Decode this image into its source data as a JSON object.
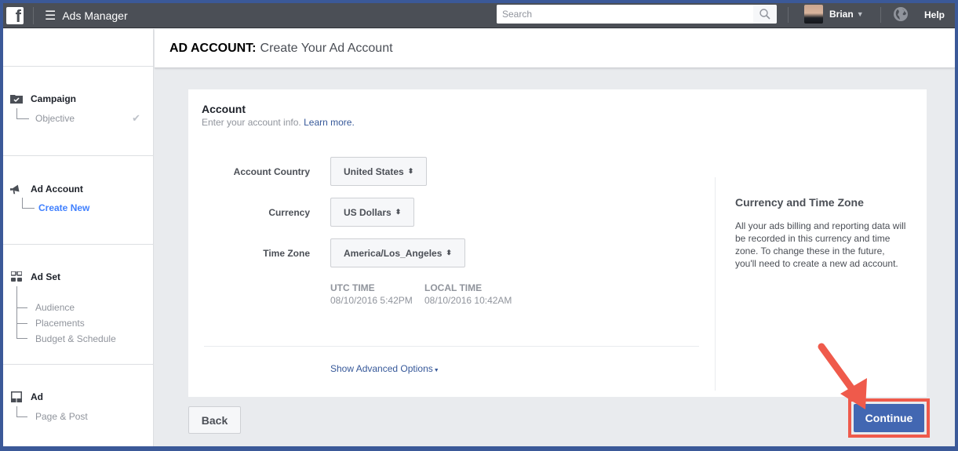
{
  "topbar": {
    "logo_glyph": "f",
    "menu_icon": "☰",
    "app_title": "Ads Manager",
    "search_placeholder": "Search",
    "user_name": "Brian",
    "help_label": "Help"
  },
  "sidebar": {
    "sections": [
      {
        "title": "Campaign",
        "icon": "folder-check-icon",
        "items": [
          {
            "label": "Objective",
            "completed": true
          }
        ]
      },
      {
        "title": "Ad Account",
        "icon": "megaphone-icon",
        "items": [
          {
            "label": "Create New",
            "active": true
          }
        ]
      },
      {
        "title": "Ad Set",
        "icon": "grid-icon",
        "items": [
          {
            "label": "Audience"
          },
          {
            "label": "Placements"
          },
          {
            "label": "Budget & Schedule"
          }
        ]
      },
      {
        "title": "Ad",
        "icon": "ad-layout-icon",
        "items": [
          {
            "label": "Page & Post"
          }
        ]
      }
    ]
  },
  "header": {
    "prefix": "AD ACCOUNT:",
    "title": "Create Your Ad Account"
  },
  "account": {
    "title": "Account",
    "description": "Enter your account info.",
    "learn_more": "Learn more.",
    "fields": {
      "country": {
        "label": "Account Country",
        "value": "United States"
      },
      "currency": {
        "label": "Currency",
        "value": "US Dollars"
      },
      "timezone": {
        "label": "Time Zone",
        "value": "America/Los_Angeles"
      }
    },
    "utc": {
      "label": "UTC TIME",
      "value": "08/10/2016 5:42PM"
    },
    "local": {
      "label": "LOCAL TIME",
      "value": "08/10/2016 10:42AM"
    },
    "advanced_link": "Show Advanced Options",
    "select_arrows": "⬍",
    "dropdown_tri": "▼"
  },
  "info": {
    "title": "Currency and Time Zone",
    "text": "All your ads billing and reporting data will be recorded in this currency and time zone. To change these in the future, you'll need to create a new ad account."
  },
  "footer": {
    "back_label": "Back",
    "continue_label": "Continue"
  },
  "colors": {
    "brand": "#3b5998",
    "topbar": "#4b4f56",
    "primary_button": "#4267b2",
    "active_link": "#4080ff",
    "annotation": "#ef5a4b"
  }
}
